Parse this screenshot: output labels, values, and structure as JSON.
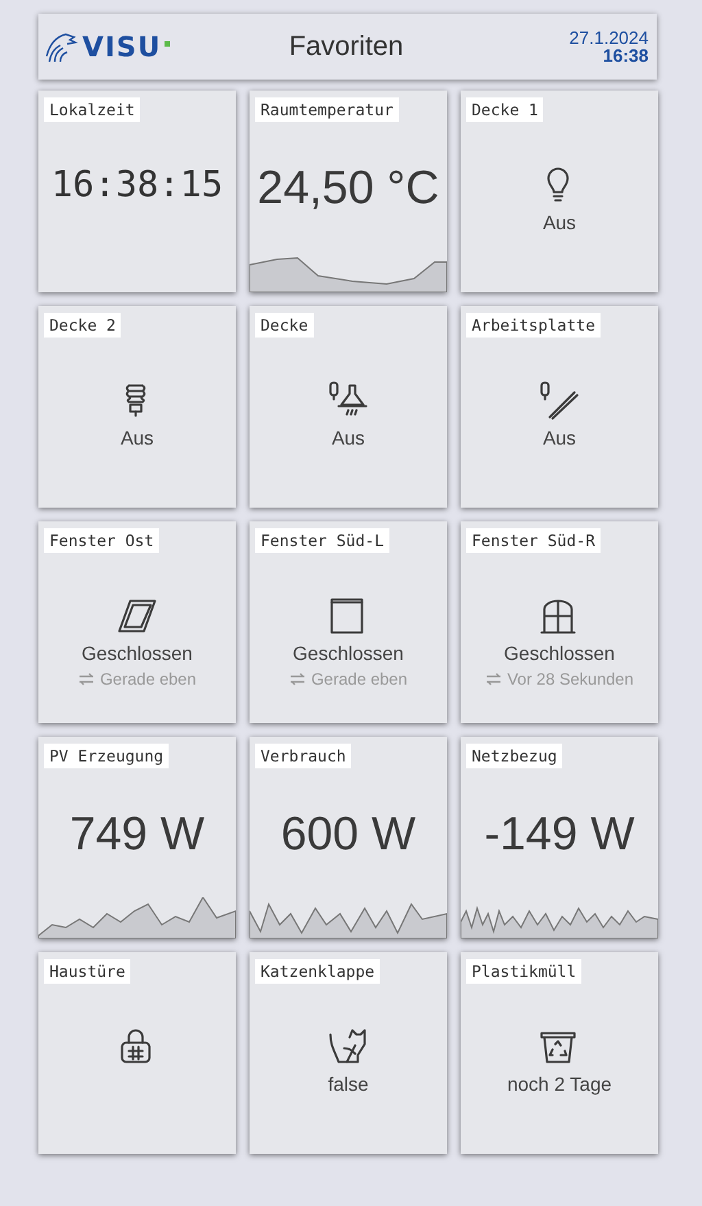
{
  "header": {
    "logo": "VISU",
    "title": "Favoriten",
    "date": "27.1.2024",
    "time": "16:38"
  },
  "tiles": [
    {
      "kind": "clock",
      "label": "Lokalzeit",
      "value": "16:38:15"
    },
    {
      "kind": "value",
      "label": "Raumtemperatur",
      "value": "24,50 °C"
    },
    {
      "kind": "icon",
      "label": "Decke 1",
      "status": "Aus"
    },
    {
      "kind": "icon",
      "label": "Decke 2",
      "status": "Aus"
    },
    {
      "kind": "icon",
      "label": "Decke",
      "status": "Aus"
    },
    {
      "kind": "icon",
      "label": "Arbeitsplatte",
      "status": "Aus"
    },
    {
      "kind": "icon",
      "label": "Fenster Ost",
      "status": "Geschlossen",
      "sub": "Gerade eben"
    },
    {
      "kind": "icon",
      "label": "Fenster Süd-L",
      "status": "Geschlossen",
      "sub": "Gerade eben"
    },
    {
      "kind": "icon",
      "label": "Fenster Süd-R",
      "status": "Geschlossen",
      "sub": "Vor 28 Sekunden"
    },
    {
      "kind": "value",
      "label": "PV Erzeugung",
      "value": "749 W"
    },
    {
      "kind": "value",
      "label": "Verbrauch",
      "value": "600 W"
    },
    {
      "kind": "value",
      "label": "Netzbezug",
      "value": "-149 W"
    },
    {
      "kind": "icon",
      "label": "Haustüre"
    },
    {
      "kind": "icon",
      "label": "Katzenklappe",
      "status": "false"
    },
    {
      "kind": "icon",
      "label": "Plastikmüll",
      "status": "noch 2 Tage"
    }
  ]
}
